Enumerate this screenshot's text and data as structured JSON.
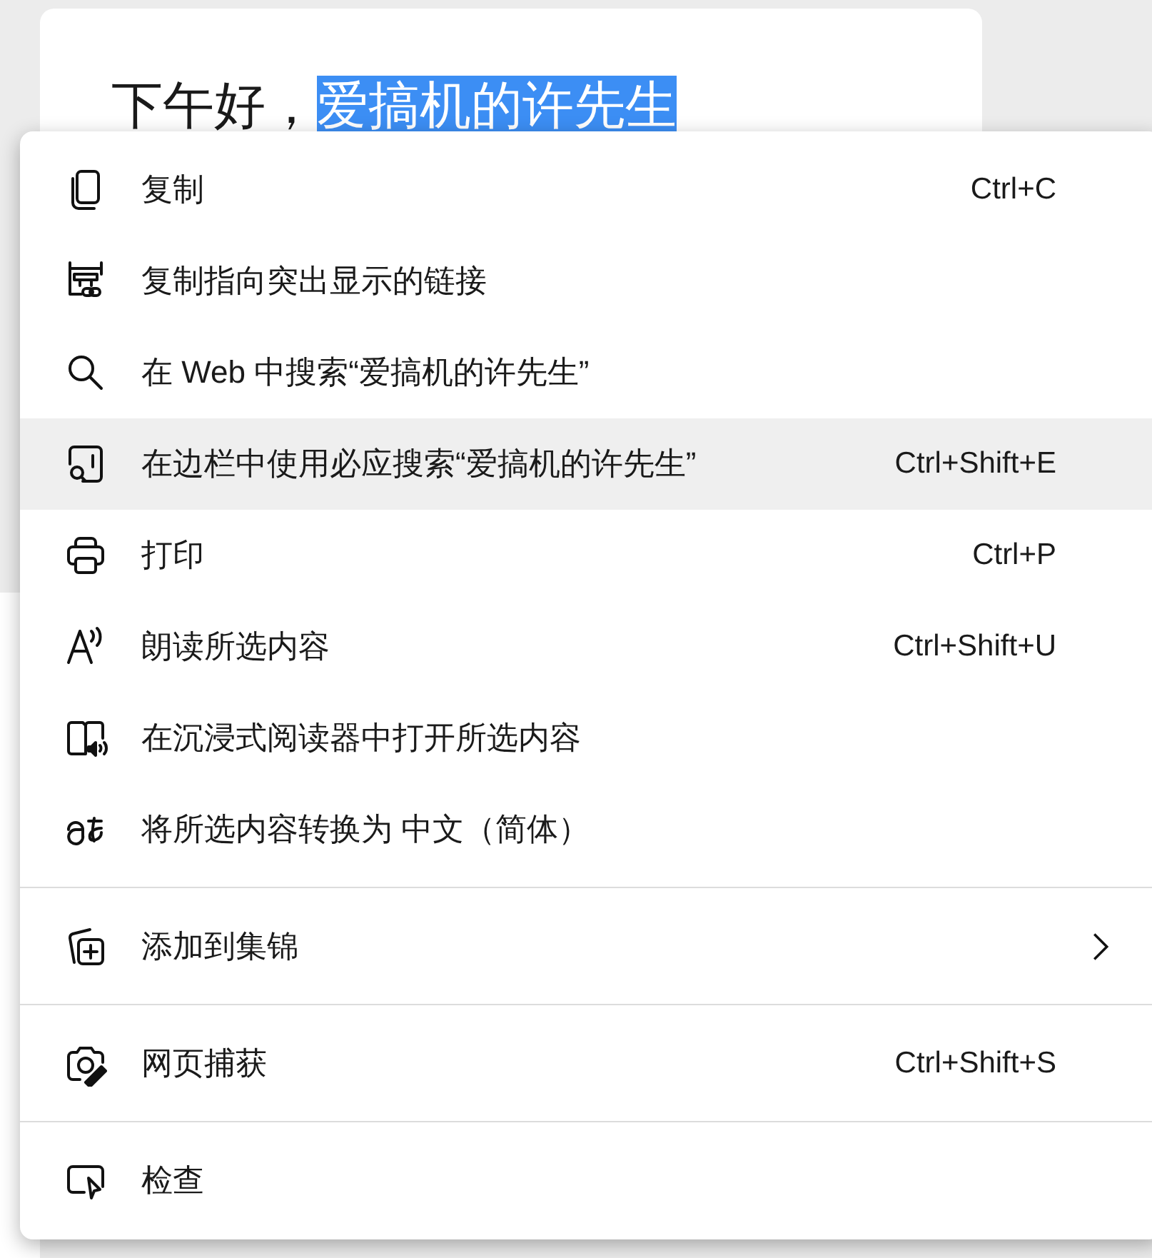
{
  "page": {
    "greeting": "下午好，",
    "selected_name": "爱搞机的许先生"
  },
  "context_menu": {
    "groups": [
      [
        {
          "label": "复制",
          "shortcut": "Ctrl+C",
          "selected": false,
          "submenu": false
        },
        {
          "label": "复制指向突出显示的链接",
          "selected": false,
          "submenu": false
        },
        {
          "label": "在 Web 中搜索“爱搞机的许先生”",
          "selected": false,
          "submenu": false
        },
        {
          "label": "在边栏中使用必应搜索“爱搞机的许先生”",
          "shortcut": "Ctrl+Shift+E",
          "selected": true,
          "submenu": false
        },
        {
          "label": "打印",
          "shortcut": "Ctrl+P",
          "selected": false,
          "submenu": false
        },
        {
          "label": "朗读所选内容",
          "shortcut": "Ctrl+Shift+U",
          "selected": false,
          "submenu": false
        },
        {
          "label": "在沉浸式阅读器中打开所选内容",
          "selected": false,
          "submenu": false
        },
        {
          "label": "将所选内容转换为 中文（简体）",
          "selected": false,
          "submenu": false
        }
      ],
      [
        {
          "label": "添加到集锦",
          "selected": false,
          "submenu": true
        }
      ],
      [
        {
          "label": "网页捕获",
          "shortcut": "Ctrl+Shift+S",
          "selected": false,
          "submenu": false
        }
      ],
      [
        {
          "label": "检查",
          "selected": false,
          "submenu": false
        }
      ]
    ]
  }
}
